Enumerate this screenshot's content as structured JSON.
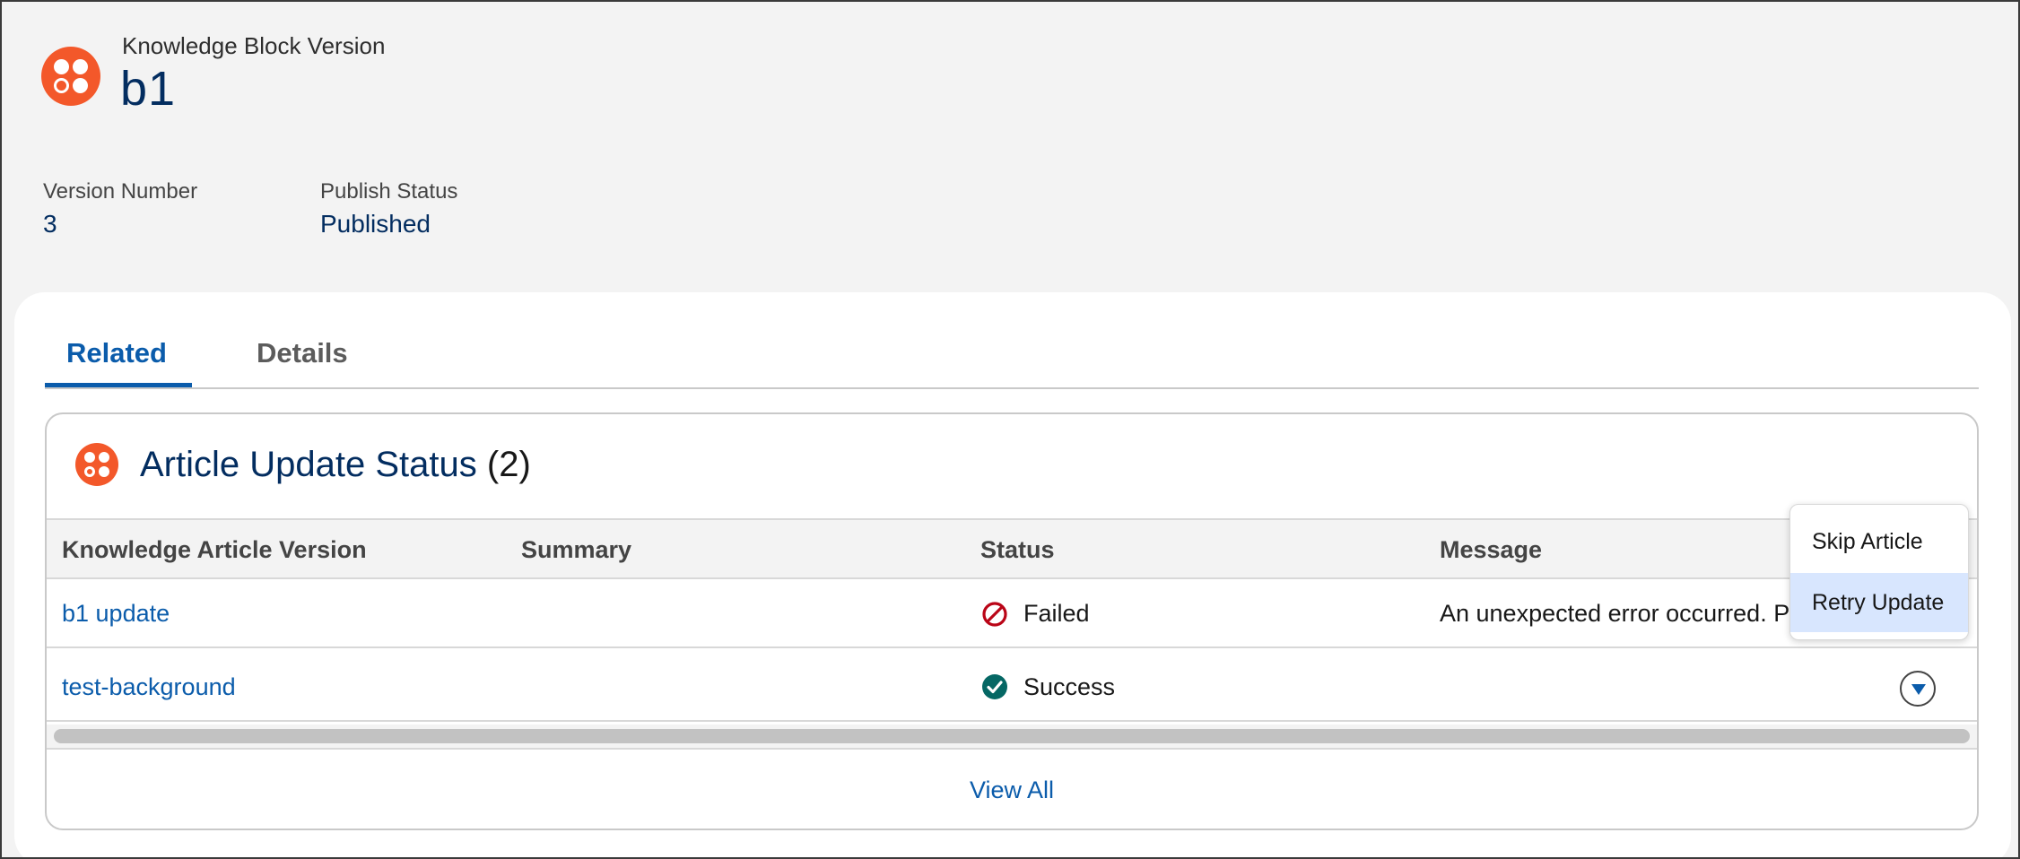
{
  "header": {
    "object_label": "Knowledge Block Version",
    "record_title": "b1",
    "icon": "knowledge-block-icon",
    "icon_color": "#f3582a"
  },
  "fields": [
    {
      "label": "Version Number",
      "value": "3"
    },
    {
      "label": "Publish Status",
      "value": "Published"
    }
  ],
  "tabs": {
    "related": "Related",
    "details": "Details",
    "active": "Related"
  },
  "related_list": {
    "title": "Article Update Status",
    "count": "(2)",
    "icon": "article-update-status-icon",
    "columns": [
      "Knowledge Article Version",
      "Summary",
      "Status",
      "Message"
    ],
    "rows": [
      {
        "article": "b1 update",
        "summary": "",
        "status": "Failed",
        "status_icon": "failed-icon",
        "message": "An unexpected error occurred. P"
      },
      {
        "article": "test-background",
        "summary": "",
        "status": "Success",
        "status_icon": "success-check-icon",
        "message": ""
      }
    ],
    "footer_link": "View All"
  },
  "row_menu": {
    "items": [
      "Skip Article",
      "Retry Update"
    ],
    "highlighted": "Retry Update"
  },
  "colors": {
    "brand_blue": "#0b5cab",
    "title_navy": "#032d60",
    "failed": "#ba0517",
    "success": "#056764"
  }
}
